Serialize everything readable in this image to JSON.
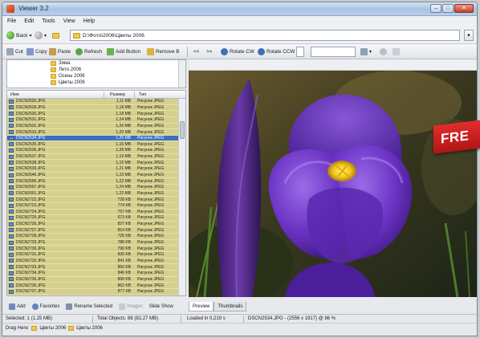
{
  "window": {
    "title": "Viewer 3.2",
    "controls": [
      "–",
      "□",
      "✕"
    ]
  },
  "menu": [
    "File",
    "Edit",
    "Tools",
    "View",
    "Help"
  ],
  "nav": {
    "back_label": "Back",
    "forward_label": ""
  },
  "address": {
    "path": "D:\\Фото\\2006\\Цветы 2006"
  },
  "toolbar": {
    "cut": "Cut",
    "copy": "Copy",
    "paste": "Paste",
    "refresh": "Refresh",
    "add_button": "Add Button",
    "remove_button": "Remove B",
    "prev": "<<",
    "next": ">>",
    "rotate_cw": "Rotate CW",
    "rotate_ccw": "Rotate CCW"
  },
  "tree": {
    "items": [
      {
        "label": "Зима"
      },
      {
        "label": "Лето 2006"
      },
      {
        "label": "Осень 2006"
      },
      {
        "label": "Цветы 2006"
      }
    ]
  },
  "filelist": {
    "columns": {
      "name": "Имя",
      "size": "Размер",
      "type": "Тип"
    },
    "rows": [
      {
        "name": "DSCN2520.JPG",
        "size": "1,11 MB",
        "type": "Рисунок JPEG"
      },
      {
        "name": "DSCN2528.JPG",
        "size": "1,18 MB",
        "type": "Рисунок JPEG"
      },
      {
        "name": "DSCN2530.JPG",
        "size": "1,18 MB",
        "type": "Рисунок JPEG"
      },
      {
        "name": "DSCN2531.JPG",
        "size": "1,24 MB",
        "type": "Рисунок JPEG"
      },
      {
        "name": "DSCN2532.JPG",
        "size": "1,26 MB",
        "type": "Рисунок JPEG"
      },
      {
        "name": "DSCN2533.JPG",
        "size": "1,20 MB",
        "type": "Рисунок JPEG"
      },
      {
        "name": "DSCN2534.JPG",
        "size": "1,25 MB",
        "type": "Рисунок JPEG",
        "selected": true
      },
      {
        "name": "DSCN2535.JPG",
        "size": "1,16 MB",
        "type": "Рисунок JPEG"
      },
      {
        "name": "DSCN2536.JPG",
        "size": "1,28 MB",
        "type": "Рисунок JPEG"
      },
      {
        "name": "DSCN2537.JPG",
        "size": "1,19 MB",
        "type": "Рисунок JPEG"
      },
      {
        "name": "DSCN2538.JPG",
        "size": "1,15 MB",
        "type": "Рисунок JPEG"
      },
      {
        "name": "DSCN2539.JPG",
        "size": "1,21 MB",
        "type": "Рисунок JPEG"
      },
      {
        "name": "DSCN2540.JPG",
        "size": "1,23 MB",
        "type": "Рисунок JPEG"
      },
      {
        "name": "DSCN2596.JPG",
        "size": "1,22 MB",
        "type": "Рисунок JPEG"
      },
      {
        "name": "DSCN2597.JPG",
        "size": "1,24 MB",
        "type": "Рисунок JPEG"
      },
      {
        "name": "DSCN2601.JPG",
        "size": "1,22 MB",
        "type": "Рисунок JPEG"
      },
      {
        "name": "DSCN2722.JPG",
        "size": "728 KB",
        "type": "Рисунок JPEG"
      },
      {
        "name": "DSCN2723.JPG",
        "size": "774 KB",
        "type": "Рисунок JPEG"
      },
      {
        "name": "DSCN2724.JPG",
        "size": "757 KB",
        "type": "Рисунок JPEG"
      },
      {
        "name": "DSCN2725.JPG",
        "size": "673 KB",
        "type": "Рисунок JPEG"
      },
      {
        "name": "DSCN2726.JPG",
        "size": "827 KB",
        "type": "Рисунок JPEG"
      },
      {
        "name": "DSCN2727.JPG",
        "size": "814 KB",
        "type": "Рисунок JPEG"
      },
      {
        "name": "DSCN2728.JPG",
        "size": "725 KB",
        "type": "Рисунок JPEG"
      },
      {
        "name": "DSCN2729.JPG",
        "size": "788 KB",
        "type": "Рисунок JPEG"
      },
      {
        "name": "DSCN2730.JPG",
        "size": "790 KB",
        "type": "Рисунок JPEG"
      },
      {
        "name": "DSCN2731.JPG",
        "size": "839 KB",
        "type": "Рисунок JPEG"
      },
      {
        "name": "DSCN2732.JPG",
        "size": "841 KB",
        "type": "Рисунок JPEG"
      },
      {
        "name": "DSCN2733.JPG",
        "size": "850 KB",
        "type": "Рисунок JPEG"
      },
      {
        "name": "DSCN2734.JPG",
        "size": "846 KB",
        "type": "Рисунок JPEG"
      },
      {
        "name": "DSCN2735.JPG",
        "size": "858 KB",
        "type": "Рисунок JPEG"
      },
      {
        "name": "DSCN2736.JPG",
        "size": "862 KB",
        "type": "Рисунок JPEG"
      },
      {
        "name": "DSCN2737.JPG",
        "size": "877 KB",
        "type": "Рисунок JPEG"
      }
    ]
  },
  "left_buttons": {
    "add": "Add",
    "favorites": "Favorites",
    "rename": "Rename Selected",
    "images": "Images",
    "slideshow": "Slide Show"
  },
  "tabs": {
    "preview": "Preview",
    "thumbnails": "Thumbnails"
  },
  "badge": {
    "text": "FRE"
  },
  "status": {
    "selected": "Selected: 1 (1,25 MB)",
    "total": "Total Objects: 88 (82,27 MB)",
    "loaded": "Loaded in 0,219 s",
    "info": "DSCN2534.JPG - (2556 x 1917) @ 86 %"
  },
  "breadcrumb": {
    "prefix": "Drag Here:",
    "items": [
      "Цветы 2006",
      "Цветы 2006"
    ]
  },
  "colors": {
    "row_bg": "#d6d08e",
    "selected_bg": "#3a6fc4",
    "badge_red": "#d42020"
  }
}
